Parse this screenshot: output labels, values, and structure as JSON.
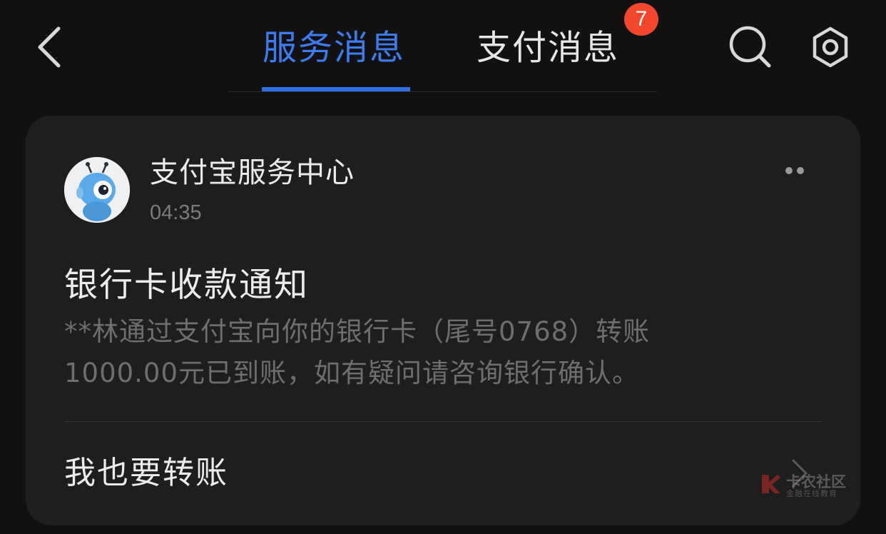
{
  "header": {
    "tabs": [
      {
        "label": "服务消息",
        "active": true
      },
      {
        "label": "支付消息",
        "active": false,
        "badge": "7"
      }
    ],
    "icons": [
      "back-icon",
      "search-icon",
      "gear-icon"
    ],
    "colors": {
      "accent": "#2f6fe6",
      "badge": "#f2472d",
      "background": "#111111",
      "card": "#1e1e1e"
    }
  },
  "message": {
    "sender": "支付宝服务中心",
    "time": "04:35",
    "title": "银行卡收款通知",
    "body": "**林通过支付宝向你的银行卡（尾号0768）转账1000.00元已到账，如有疑问请咨询银行确认。",
    "action_label": "我也要转账"
  },
  "watermark": {
    "name": "卡农社区",
    "subtitle": "金融在线教育"
  }
}
